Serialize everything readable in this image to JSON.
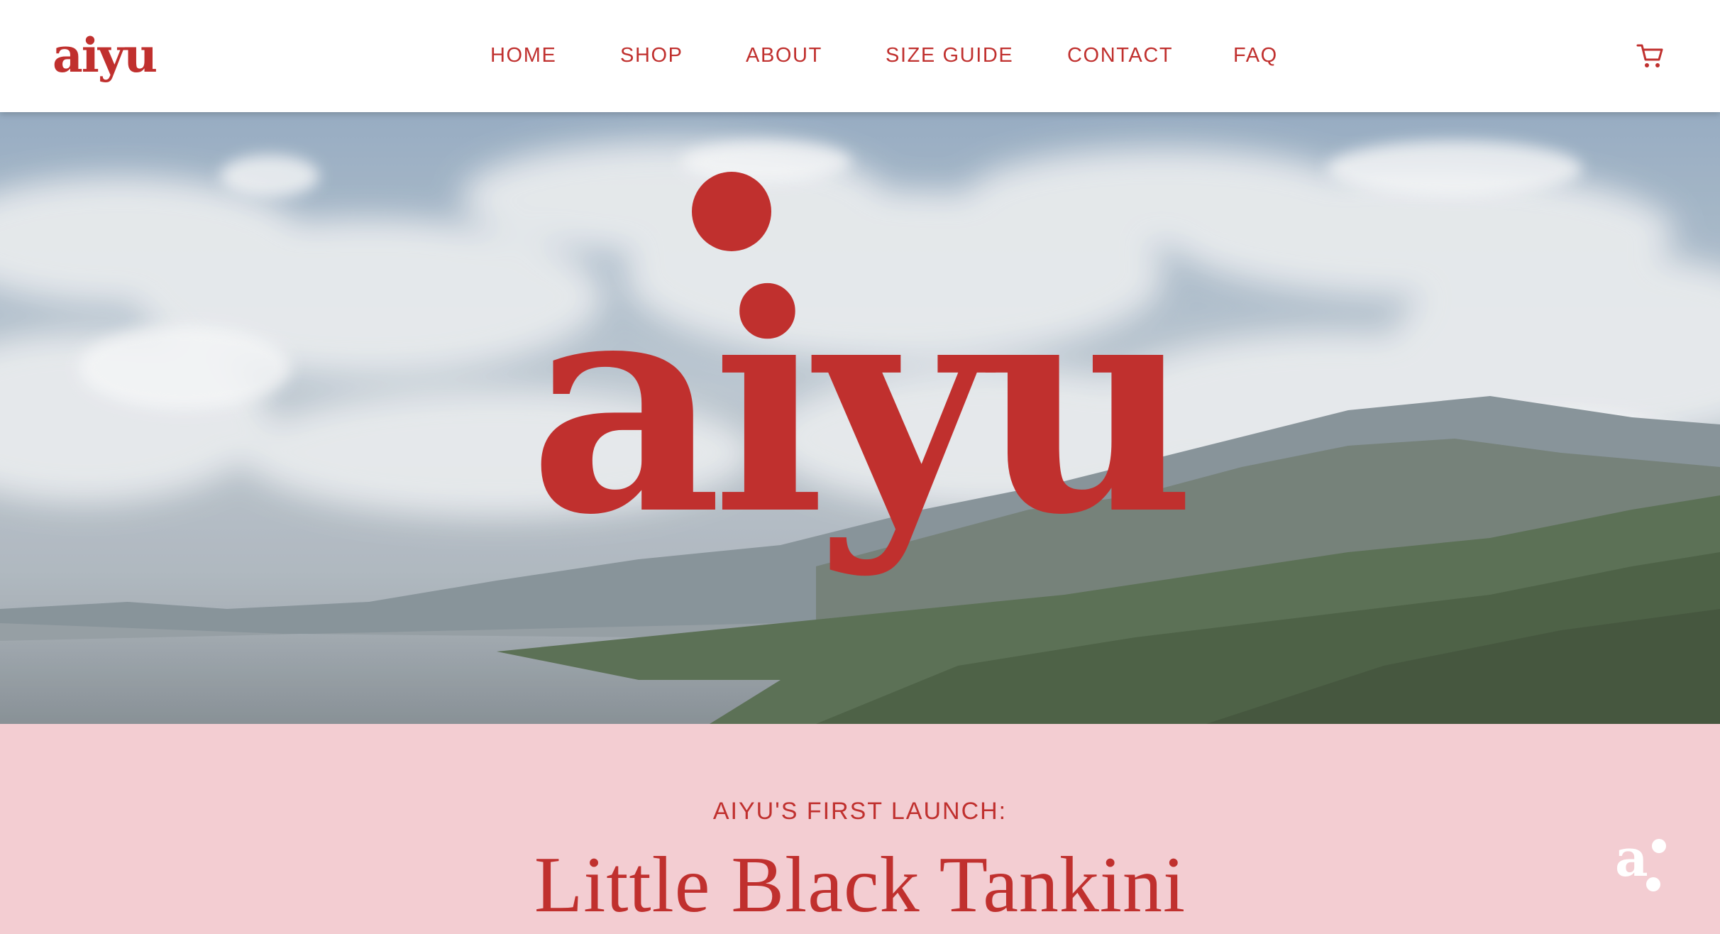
{
  "brand": {
    "logo_text": "aiyu",
    "accent_color": "#c0302e",
    "pink_color": "#f3cdd2"
  },
  "nav": {
    "items": [
      {
        "label": "HOME"
      },
      {
        "label": "SHOP"
      },
      {
        "label": "ABOUT"
      },
      {
        "label": "SIZE GUIDE"
      },
      {
        "label": "CONTACT"
      },
      {
        "label": "FAQ"
      }
    ],
    "cart_icon": "shopping-cart-icon"
  },
  "hero": {
    "logo_text": "aiyu",
    "background": "sky-clouds-mountains-lake-photo"
  },
  "launch": {
    "kicker": "AIYU'S FIRST LAUNCH:",
    "title": "Little Black Tankini",
    "badge_icon": "aiyu-monogram-icon"
  }
}
